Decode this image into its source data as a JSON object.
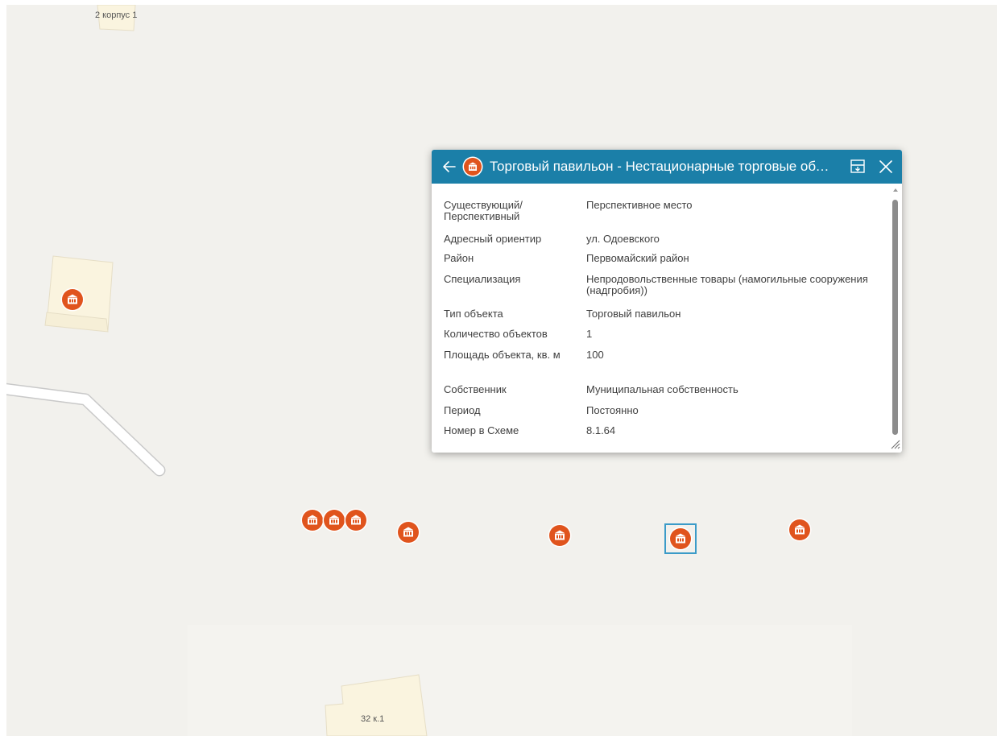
{
  "map": {
    "building_labels": [
      "2 корпус 1",
      "32 к.1"
    ],
    "poi_icon": "market-pavilion-icon",
    "poi_color": "#e0541d",
    "selection_color": "#3b9bc8"
  },
  "popup": {
    "title": "Торговый павильон - Нестационарные торговые объекты",
    "header_color": "#1b7fa8",
    "icons": {
      "back": "arrow-left-icon",
      "dock": "dock-icon",
      "close": "close-icon"
    },
    "attributes": [
      {
        "key": "Существующий/ Перспективный",
        "value": "Перспективное место"
      },
      {
        "key": "Адресный ориентир",
        "value": "ул. Одоевского"
      },
      {
        "key": "Район",
        "value": "Первомайский район"
      },
      {
        "key": "Специализация",
        "value": "Непродовольственные товары (намогильные сооружения (надгробия))"
      },
      {
        "key": "Тип объекта",
        "value": "Торговый павильон"
      },
      {
        "key": "Количество объектов",
        "value": "1"
      },
      {
        "key": "Площадь объекта, кв. м",
        "value": "100"
      },
      {
        "key": "Собственник",
        "value": "Муниципальная собственность"
      },
      {
        "key": "Период",
        "value": "Постоянно"
      },
      {
        "key": "Номер в Схеме",
        "value": "8.1.64"
      }
    ]
  }
}
